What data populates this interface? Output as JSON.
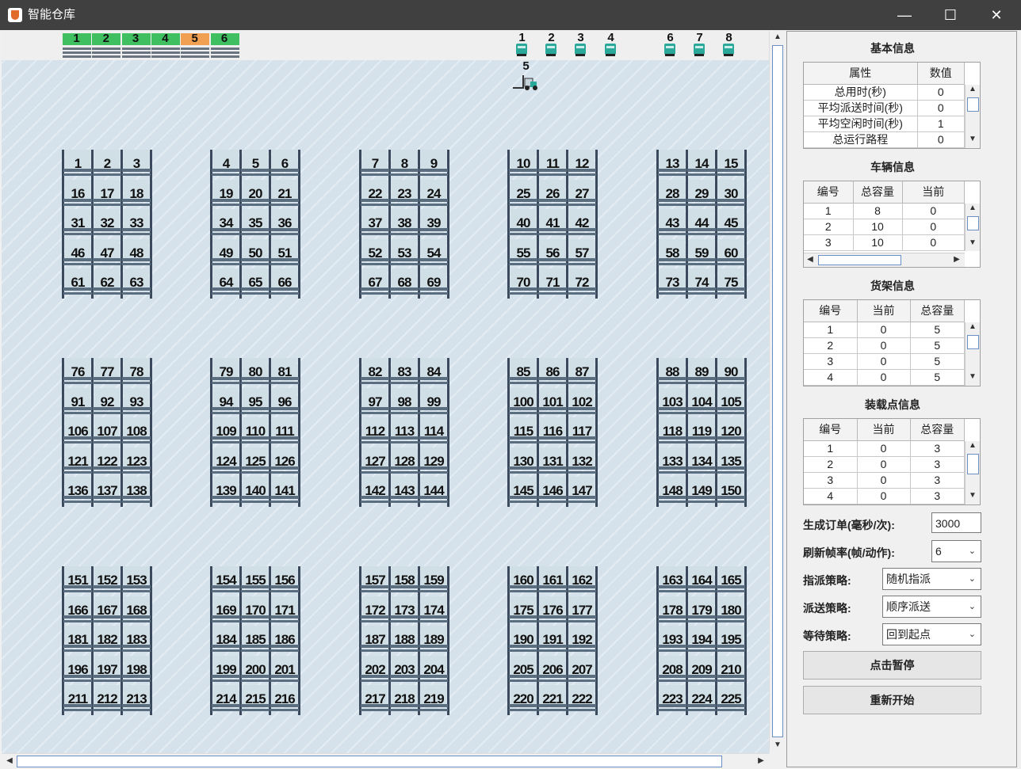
{
  "window": {
    "title": "智能仓库"
  },
  "docks": [
    {
      "label": "1",
      "color": "#3fbf5f"
    },
    {
      "label": "2",
      "color": "#3fbf5f"
    },
    {
      "label": "3",
      "color": "#3fbf5f"
    },
    {
      "label": "4",
      "color": "#3fbf5f"
    },
    {
      "label": "5",
      "color": "#f0a050"
    },
    {
      "label": "6",
      "color": "#3fbf5f"
    }
  ],
  "forklifts_parked": [
    "1",
    "2",
    "3",
    "4",
    "6",
    "7",
    "8"
  ],
  "forklift_moving": "5",
  "racks": [
    [
      [
        1,
        2,
        3
      ],
      [
        16,
        17,
        18
      ],
      [
        31,
        32,
        33
      ],
      [
        46,
        47,
        48
      ],
      [
        61,
        62,
        63
      ]
    ],
    [
      [
        4,
        5,
        6
      ],
      [
        19,
        20,
        21
      ],
      [
        34,
        35,
        36
      ],
      [
        49,
        50,
        51
      ],
      [
        64,
        65,
        66
      ]
    ],
    [
      [
        7,
        8,
        9
      ],
      [
        22,
        23,
        24
      ],
      [
        37,
        38,
        39
      ],
      [
        52,
        53,
        54
      ],
      [
        67,
        68,
        69
      ]
    ],
    [
      [
        10,
        11,
        12
      ],
      [
        25,
        26,
        27
      ],
      [
        40,
        41,
        42
      ],
      [
        55,
        56,
        57
      ],
      [
        70,
        71,
        72
      ]
    ],
    [
      [
        13,
        14,
        15
      ],
      [
        28,
        29,
        30
      ],
      [
        43,
        44,
        45
      ],
      [
        58,
        59,
        60
      ],
      [
        73,
        74,
        75
      ]
    ],
    [
      [
        76,
        77,
        78
      ],
      [
        91,
        92,
        93
      ],
      [
        106,
        107,
        108
      ],
      [
        121,
        122,
        123
      ],
      [
        136,
        137,
        138
      ]
    ],
    [
      [
        79,
        80,
        81
      ],
      [
        94,
        95,
        96
      ],
      [
        109,
        110,
        111
      ],
      [
        124,
        125,
        126
      ],
      [
        139,
        140,
        141
      ]
    ],
    [
      [
        82,
        83,
        84
      ],
      [
        97,
        98,
        99
      ],
      [
        112,
        113,
        114
      ],
      [
        127,
        128,
        129
      ],
      [
        142,
        143,
        144
      ]
    ],
    [
      [
        85,
        86,
        87
      ],
      [
        100,
        101,
        102
      ],
      [
        115,
        116,
        117
      ],
      [
        130,
        131,
        132
      ],
      [
        145,
        146,
        147
      ]
    ],
    [
      [
        88,
        89,
        90
      ],
      [
        103,
        104,
        105
      ],
      [
        118,
        119,
        120
      ],
      [
        133,
        134,
        135
      ],
      [
        148,
        149,
        150
      ]
    ],
    [
      [
        151,
        152,
        153
      ],
      [
        166,
        167,
        168
      ],
      [
        181,
        182,
        183
      ],
      [
        196,
        197,
        198
      ],
      [
        211,
        212,
        213
      ]
    ],
    [
      [
        154,
        155,
        156
      ],
      [
        169,
        170,
        171
      ],
      [
        184,
        185,
        186
      ],
      [
        199,
        200,
        201
      ],
      [
        214,
        215,
        216
      ]
    ],
    [
      [
        157,
        158,
        159
      ],
      [
        172,
        173,
        174
      ],
      [
        187,
        188,
        189
      ],
      [
        202,
        203,
        204
      ],
      [
        217,
        218,
        219
      ]
    ],
    [
      [
        160,
        161,
        162
      ],
      [
        175,
        176,
        177
      ],
      [
        190,
        191,
        192
      ],
      [
        205,
        206,
        207
      ],
      [
        220,
        221,
        222
      ]
    ],
    [
      [
        163,
        164,
        165
      ],
      [
        178,
        179,
        180
      ],
      [
        193,
        194,
        195
      ],
      [
        208,
        209,
        210
      ],
      [
        223,
        224,
        225
      ]
    ]
  ],
  "basic": {
    "heading": "基本信息",
    "headers": [
      "属性",
      "数值"
    ],
    "rows": [
      [
        "总用时(秒)",
        "0"
      ],
      [
        "平均派送时间(秒)",
        "0"
      ],
      [
        "平均空闲时间(秒)",
        "1"
      ],
      [
        "总运行路程",
        "0"
      ]
    ]
  },
  "vehicles": {
    "heading": "车辆信息",
    "headers": [
      "编号",
      "总容量",
      "当前"
    ],
    "rows": [
      [
        "1",
        "8",
        "0"
      ],
      [
        "2",
        "10",
        "0"
      ],
      [
        "3",
        "10",
        "0"
      ]
    ]
  },
  "shelves": {
    "heading": "货架信息",
    "headers": [
      "编号",
      "当前",
      "总容量"
    ],
    "rows": [
      [
        "1",
        "0",
        "5"
      ],
      [
        "2",
        "0",
        "5"
      ],
      [
        "3",
        "0",
        "5"
      ],
      [
        "4",
        "0",
        "5"
      ]
    ]
  },
  "loading": {
    "heading": "装载点信息",
    "headers": [
      "编号",
      "当前",
      "总容量"
    ],
    "rows": [
      [
        "1",
        "0",
        "3"
      ],
      [
        "2",
        "0",
        "3"
      ],
      [
        "3",
        "0",
        "3"
      ],
      [
        "4",
        "0",
        "3"
      ]
    ]
  },
  "form": {
    "order_label": "生成订单(毫秒/次):",
    "order_value": "3000",
    "fps_label": "刷新帧率(帧/动作):",
    "fps_value": "6",
    "assign_label": "指派策略:",
    "assign_value": "随机指派",
    "dispatch_label": "派送策略:",
    "dispatch_value": "顺序派送",
    "wait_label": "等待策略:",
    "wait_value": "回到起点"
  },
  "buttons": {
    "pause": "点击暂停",
    "restart": "重新开始"
  }
}
